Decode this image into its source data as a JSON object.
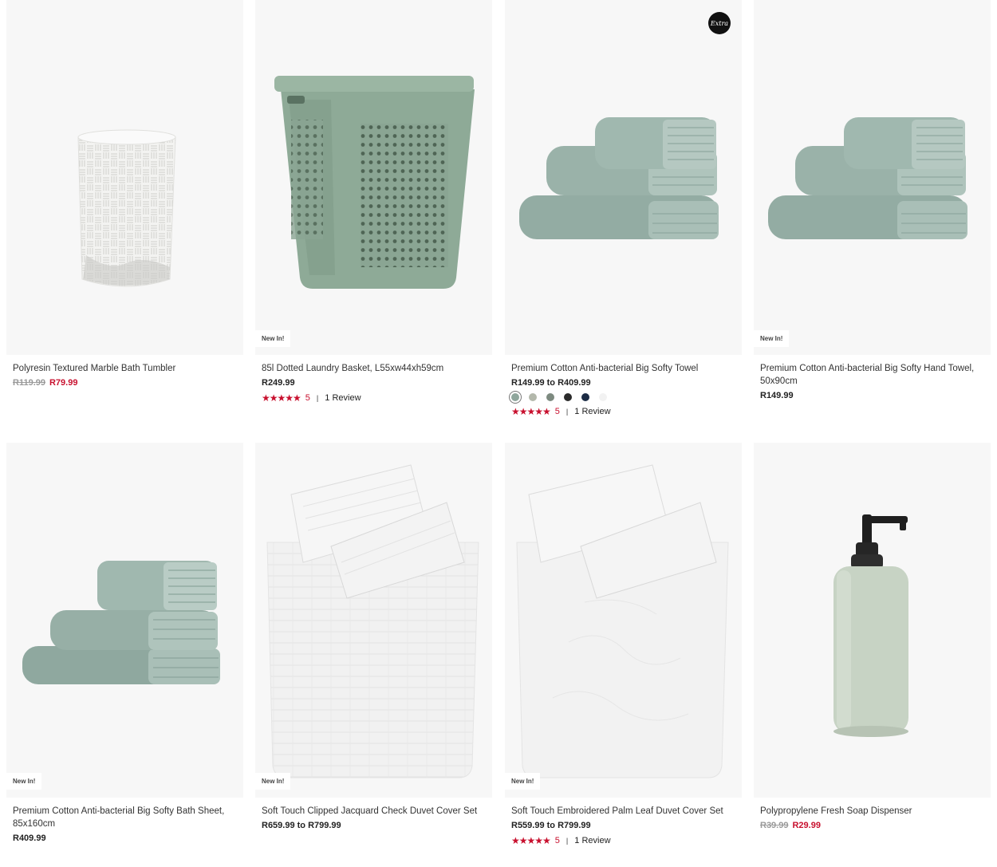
{
  "products": [
    {
      "name": "Polyresin Textured Marble Bath Tumbler",
      "was": "R119.99",
      "now": "R79.99",
      "price": ""
    },
    {
      "name": "85l Dotted Laundry Basket, L55xw44xh59cm",
      "badge": "New In!",
      "price": "R249.99",
      "rating": "5",
      "reviews": "1 Review"
    },
    {
      "name": "Premium Cotton Anti-bacterial Big Softy Towel",
      "price": "R149.99 to R409.99",
      "rating": "5",
      "reviews": "1 Review",
      "extra": "Extra",
      "swatches": [
        "#8fa69c",
        "#b3b8ab",
        "#7d8a80",
        "#2b2b2b",
        "#1c2c45",
        "#f2f2f2"
      ]
    },
    {
      "name": "Premium Cotton Anti-bacterial Big Softy Hand Towel, 50x90cm",
      "badge": "New In!",
      "price": "R149.99"
    },
    {
      "name": "Premium Cotton Anti-bacterial Big Softy Bath Sheet, 85x160cm",
      "badge": "New In!",
      "price": "R409.99"
    },
    {
      "name": "Soft Touch Clipped Jacquard Check Duvet Cover Set",
      "badge": "New In!",
      "price": "R659.99 to R799.99"
    },
    {
      "name": "Soft Touch Embroidered Palm Leaf Duvet Cover Set",
      "badge": "New In!",
      "price": "R559.99 to R799.99",
      "rating": "5",
      "reviews": "1 Review"
    },
    {
      "name": "Polypropylene Fresh Soap Dispenser",
      "was": "R39.99",
      "now": "R29.99"
    }
  ],
  "stars": "★★★★★",
  "separator": "|"
}
